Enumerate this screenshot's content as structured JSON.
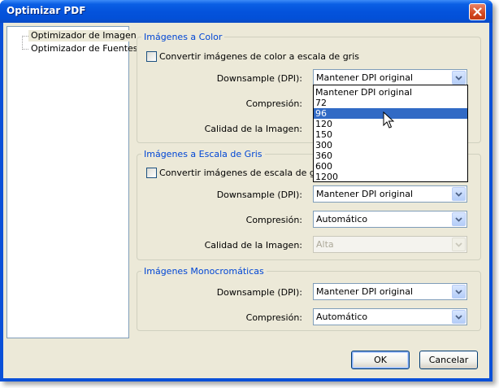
{
  "window": {
    "title": "Optimizar PDF"
  },
  "tree": {
    "items": [
      {
        "label": "Optimizador de Imagen",
        "selected": true
      },
      {
        "label": "Optimizador de Fuentes",
        "selected": false
      }
    ]
  },
  "color_group": {
    "title": "Imágenes a Color",
    "convert_label": "Convertir imágenes de color a escala de gris",
    "convert_checked": false,
    "downsample_label": "Downsample (DPI):",
    "downsample_value": "Mantener DPI original",
    "compression_label": "Compresión:",
    "quality_label": "Calidad de la Imagen:"
  },
  "dpi_dropdown": {
    "options": [
      "Mantener DPI original",
      "72",
      "96",
      "120",
      "150",
      "300",
      "360",
      "600",
      "1200"
    ],
    "highlighted": "96"
  },
  "gray_group": {
    "title": "Imágenes a Escala de Gris",
    "convert_label": "Convertir imágenes de escala de gris a",
    "convert_checked": false,
    "downsample_label": "Downsample (DPI):",
    "downsample_value": "Mantener DPI original",
    "compression_label": "Compresión:",
    "compression_value": "Automático",
    "quality_label": "Calidad de la Imagen:",
    "quality_value": "Alta",
    "quality_enabled": false
  },
  "mono_group": {
    "title": "Imágenes Monocromáticas",
    "downsample_label": "Downsample (DPI):",
    "downsample_value": "Mantener DPI original",
    "compression_label": "Compresión:",
    "compression_value": "Automático"
  },
  "buttons": {
    "ok": "OK",
    "cancel": "Cancelar"
  },
  "colors": {
    "title_bar": "#0453dc",
    "face": "#ece9d8",
    "group_title": "#0046d5",
    "highlight": "#316ac5"
  },
  "icons": {
    "close": "close-icon",
    "dropdown_arrow": "chevron-down-icon",
    "cursor": "mouse-pointer-icon"
  }
}
